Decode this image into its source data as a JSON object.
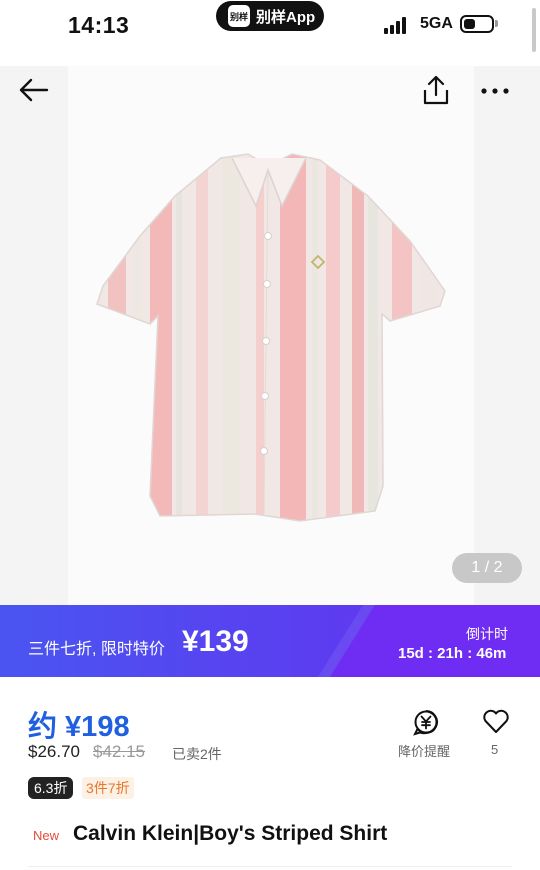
{
  "status_bar": {
    "time": "14:13",
    "app_pill_logo": "别样",
    "app_pill_label": "别样App",
    "network": "5GA",
    "signal_icon": "signal-bars-icon",
    "battery_icon": "battery-icon"
  },
  "nav": {
    "back_icon": "back-arrow-icon",
    "share_icon": "share-icon",
    "more_icon": "more-dots-icon"
  },
  "gallery": {
    "page_counter": "1 / 2",
    "colors": {
      "shirt_base": "#f3e3e1",
      "stripe_pink": "#f2b7b8",
      "stripe_light": "#eaeae4"
    }
  },
  "promo": {
    "text": "三件七折, 限时特价",
    "price": "¥139",
    "countdown_label": "倒计时",
    "countdown_value": "15d : 21h : 46m"
  },
  "product": {
    "price_cny": "约 ¥198",
    "price_usd": "$26.70",
    "price_original": "$42.15",
    "sold": "已卖2件",
    "alert_label": "降价提醒",
    "alert_icon": "yuan-bell-icon",
    "favorite_icon": "heart-icon",
    "favorite_count": "5",
    "discount_tag": "6.3折",
    "deal_tag": "3件7折",
    "new_badge": "New",
    "title": "Calvin Klein|Boy's Striped Shirt"
  },
  "theme": {
    "accent": "#1f5fe0",
    "promo_gradient_start": "#4a55f0",
    "promo_gradient_end": "#6a2df0",
    "new_badge_color": "#e24b3b",
    "deal_color": "#e8772a"
  }
}
